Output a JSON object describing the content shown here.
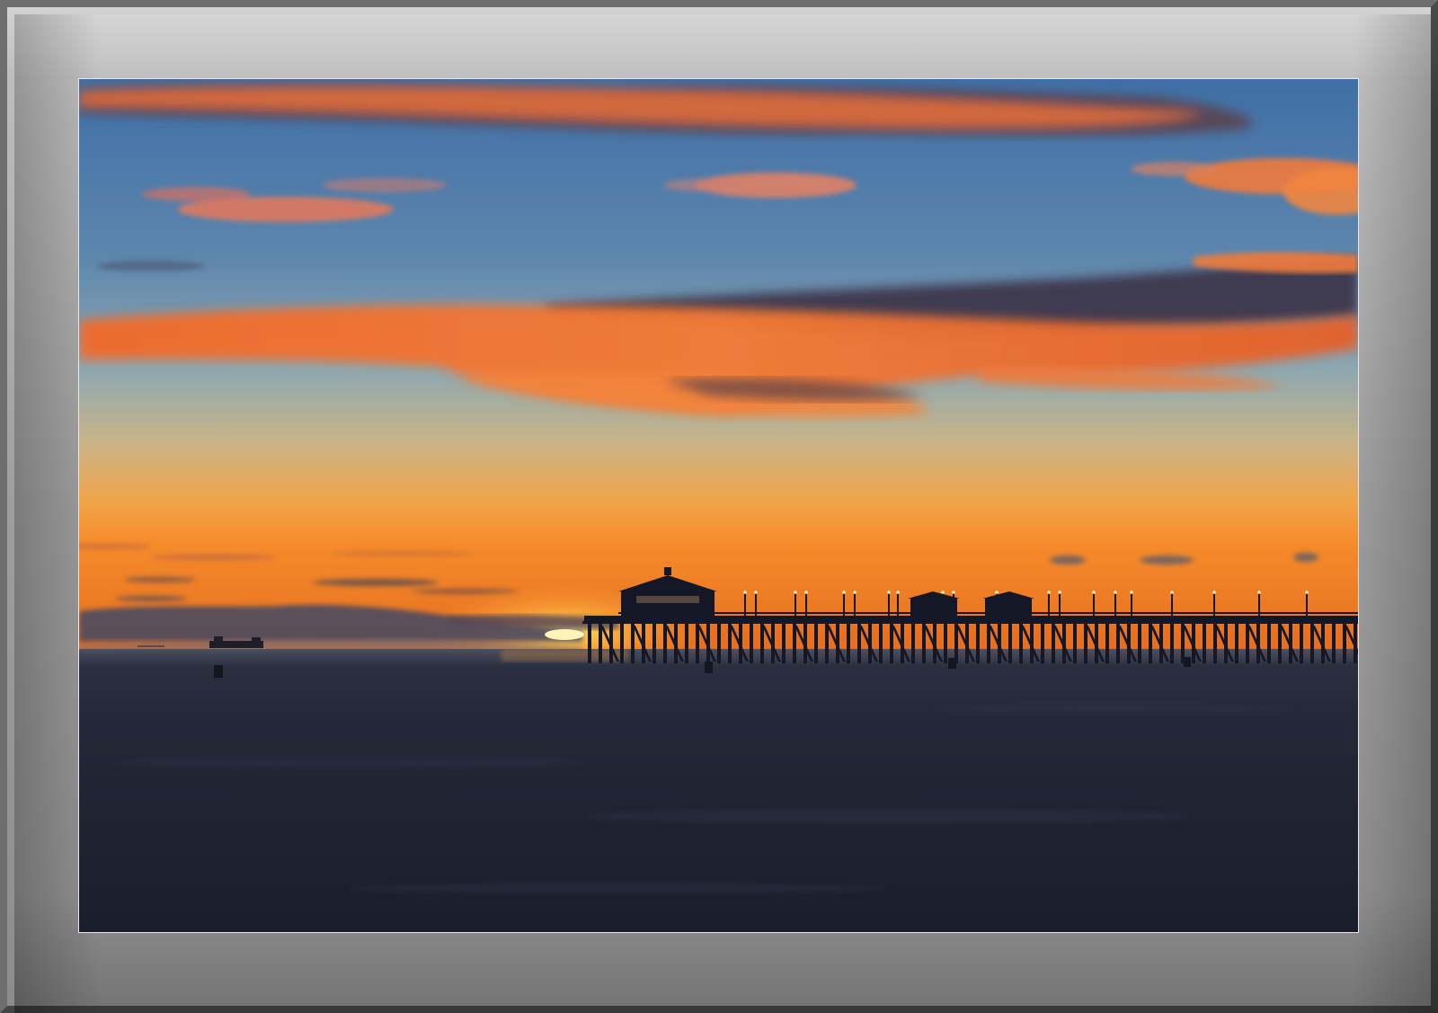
{
  "scene": {
    "subject": "pier-at-sunset",
    "colors": {
      "sky_top": "#3f6fa6",
      "sky_mid": "#7aa0b8",
      "horizon_glow": "#f6a23a",
      "sun": "#ffe07a",
      "cloud_orange": "#f56a2a",
      "cloud_dark": "#3a3246",
      "sea": "#2a3448",
      "sand": "#1e2333",
      "silhouette": "#141826",
      "frame_gray": "#a8a8a8"
    }
  }
}
